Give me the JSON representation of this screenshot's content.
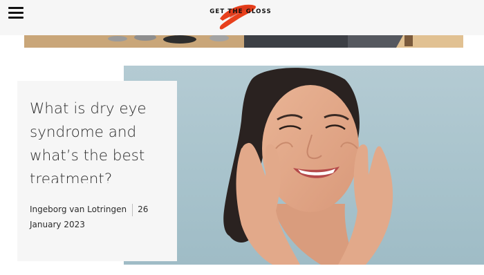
{
  "header": {
    "logo_text": "GET THE GLOSS",
    "logo_accent_color": "#e8401c"
  },
  "article": {
    "title": "What is dry eye syndrome and what’s the best treatment?",
    "author": "Ingeborg van Lotringen",
    "date": "26 January 2023"
  },
  "icons": {
    "menu": "hamburger-menu-icon"
  }
}
